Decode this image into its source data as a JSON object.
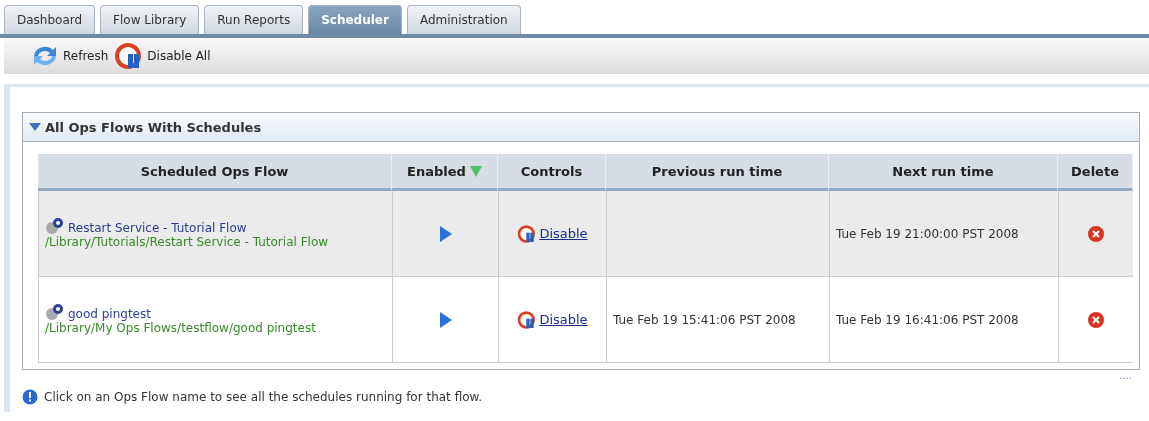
{
  "tabs": [
    {
      "label": "Dashboard",
      "selected": false
    },
    {
      "label": "Flow Library",
      "selected": false
    },
    {
      "label": "Run Reports",
      "selected": false
    },
    {
      "label": "Scheduler",
      "selected": true
    },
    {
      "label": "Administration",
      "selected": false
    }
  ],
  "toolbar": [
    {
      "kind": "refresh",
      "label": "Refresh"
    },
    {
      "kind": "disable",
      "label": "Disable All"
    }
  ],
  "panel": {
    "title": "All Ops Flows With Schedules",
    "expanded": true,
    "columns": [
      {
        "label": "Scheduled Ops Flow",
        "sorted": false
      },
      {
        "label": "Enabled",
        "sorted": true
      },
      {
        "label": "Controls",
        "sorted": false
      },
      {
        "label": "Previous run time",
        "sorted": false
      },
      {
        "label": "Next run time",
        "sorted": false
      },
      {
        "label": "Delete",
        "sorted": false
      }
    ],
    "rows": [
      {
        "name": "Restart Service - Tutorial Flow",
        "path": "/Library/Tutorials/Restart Service - Tutorial Flow",
        "enabled": true,
        "control": "Disable",
        "previous": "",
        "next": "Tue Feb 19 21:00:00 PST 2008"
      },
      {
        "name": "good pingtest",
        "path": "/Library/My Ops Flows/testflow/good pingtest",
        "enabled": true,
        "control": "Disable",
        "previous": "Tue Feb 19 15:41:06 PST 2008",
        "next": "Tue Feb 19 16:41:06 PST 2008"
      }
    ],
    "more": "...."
  },
  "note": "Click on an Ops Flow name to see all the schedules running for that flow."
}
